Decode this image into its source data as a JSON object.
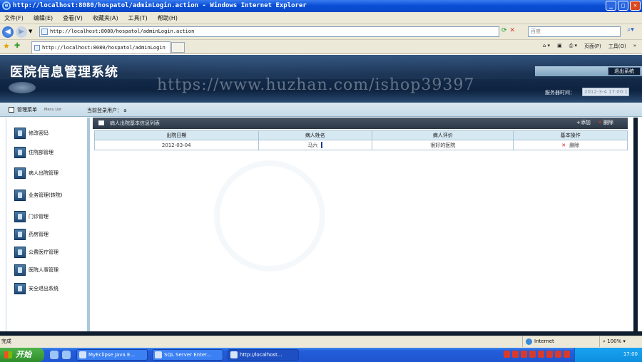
{
  "browser": {
    "window_title": "http://localhost:8080/hospatol/adminLogin.action - Windows Internet Explorer",
    "menu": [
      "文件(F)",
      "编辑(E)",
      "查看(V)",
      "收藏夹(A)",
      "工具(T)",
      "帮助(H)"
    ],
    "address": "http://localhost:8080/hospatol/adminLogin.action",
    "search_placeholder": "百度",
    "tab_title": "http://localhost:8080/hospatol/adminLogin",
    "cmd_page": "页面(P)",
    "cmd_tools": "工具(O)",
    "status_text": "完成",
    "zone": "Internet",
    "zoom": "100%"
  },
  "app": {
    "title": "医院信息管理系统",
    "watermark": "https://www.huzhan.com/ishop39397",
    "logout": "退出系统",
    "server_time_label": "服务器时间：",
    "server_time": "2012-3-4 17:00:1",
    "menu_header": "管理菜单",
    "menu_header_small": "Menu List",
    "current_user_label": "当前登录用户：",
    "current_user": "a"
  },
  "sidebar": {
    "items": [
      {
        "label": "修改密码"
      },
      {
        "label": "住院部管理"
      },
      {
        "label": "病人出院管理"
      },
      {
        "label": "业务管理(转院)"
      },
      {
        "label": "门诊管理"
      },
      {
        "label": "药房管理"
      },
      {
        "label": "公费医疗管理"
      },
      {
        "label": "医院人事管理"
      },
      {
        "label": "安全退出系统"
      }
    ]
  },
  "panel": {
    "title": "病人出院基本信息列表",
    "add": "添加",
    "delete": "删除",
    "columns": [
      "出院日期",
      "病人姓名",
      "病人评价",
      "基本操作"
    ],
    "rows": [
      {
        "date": "2012-03-04",
        "name": "马六",
        "comment": "很好的医院",
        "action": "删除"
      }
    ]
  },
  "taskbar": {
    "start": "开始",
    "tasks": [
      "MyEclipse Java E...",
      "SQL Server Enter...",
      "http://localhost..."
    ],
    "clock": "17:00"
  }
}
